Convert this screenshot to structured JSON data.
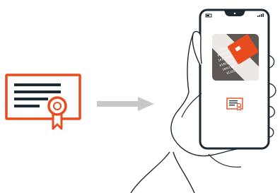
{
  "colors": {
    "accent": "#e84c1e",
    "outline": "#1e2a33",
    "arrow": "#c8c8c8",
    "app_icon_bg": "#5f5752"
  },
  "icons": {
    "certificate_large": "certificate-icon",
    "arrow": "arrow-right-icon",
    "app_icon": "binary-data-app-icon",
    "certificate_small": "certificate-icon"
  }
}
